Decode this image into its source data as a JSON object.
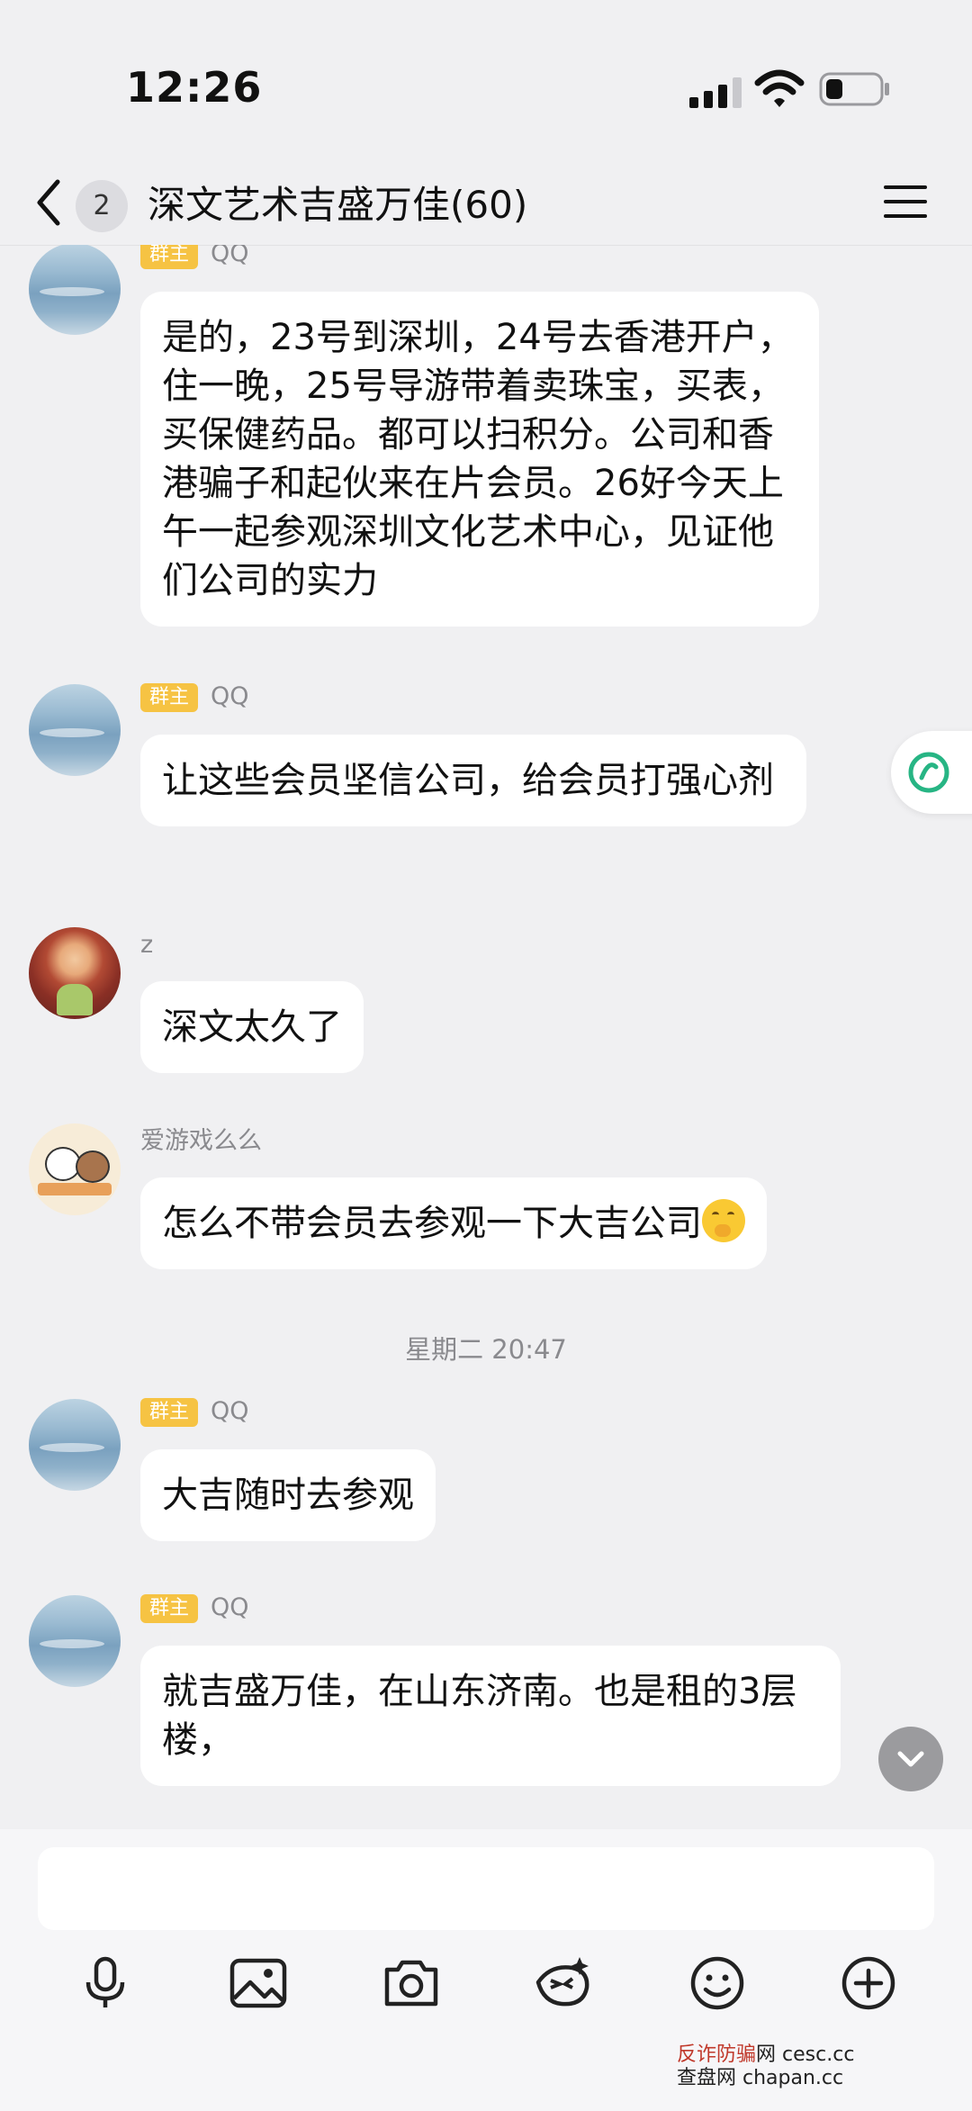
{
  "status": {
    "time": "12:26"
  },
  "nav": {
    "unread": "2",
    "title": "深文艺术吉盛万佳(60)"
  },
  "messages": {
    "m1": {
      "badge": "群主",
      "name": "QQ",
      "text": "是的，23号到深圳，24号去香港开户，住一晚，25号导游带着卖珠宝，买表，买保健药品。都可以扫积分。公司和香港骗子和起伙来在片会员。26好今天上午一起参观深圳文化艺术中心，见证他们公司的实力"
    },
    "m2": {
      "badge": "群主",
      "name": "QQ",
      "text": "让这些会员坚信公司，给会员打强心剂"
    },
    "m3": {
      "name": "z",
      "text": "深文太久了"
    },
    "m4": {
      "name": "爱游戏么么",
      "text": "怎么不带会员去参观一下大吉公司"
    },
    "divider": "星期二 20:47",
    "m5": {
      "badge": "群主",
      "name": "QQ",
      "text": "大吉随时去参观"
    },
    "m6": {
      "badge": "群主",
      "name": "QQ",
      "text": "就吉盛万佳，在山东济南。也是租的3层楼，"
    }
  },
  "input": {
    "placeholder": ""
  },
  "toolbar": [
    "microphone-icon",
    "image-icon",
    "camera-icon",
    "sticker-icon",
    "emoji-icon",
    "plus-icon"
  ],
  "watermark": {
    "line1_a": "反诈",
    "line1_b": "防骗",
    "line1_c": "网",
    "line1_d": "cesc.cc",
    "line2_a": "查盘网",
    "line2_b": "chapan.cc"
  },
  "colors": {
    "background": "#f0f0f2",
    "bubble": "#ffffff",
    "owner_badge": "#f6c343",
    "float_logo": "#27b584"
  }
}
